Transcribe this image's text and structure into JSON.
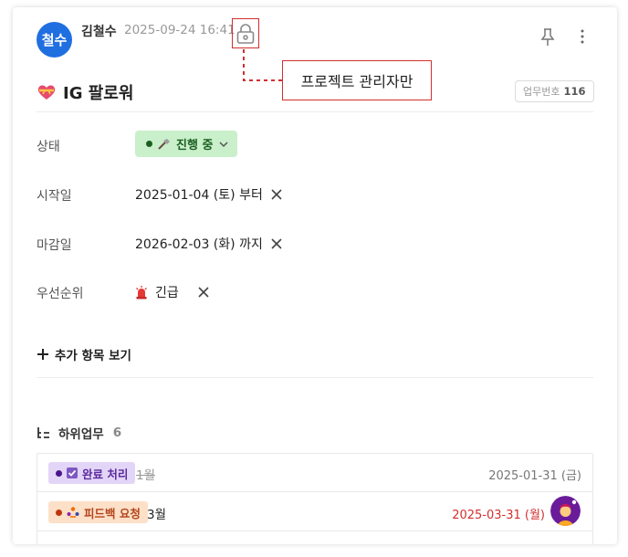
{
  "header": {
    "avatar_text": "철수",
    "author": "김철수",
    "timestamp": "2025-09-24 16:41",
    "lock_callout": "프로젝트 관리자만"
  },
  "task": {
    "title": "IG 팔로워",
    "id_label": "업무번호",
    "id_value": "116"
  },
  "properties": {
    "status": {
      "label": "상태",
      "value": "진행 중",
      "color": "#1b5e20",
      "bg": "#c9efcb"
    },
    "start": {
      "label": "시작일",
      "value": "2025-01-04 (토) 부터"
    },
    "due": {
      "label": "마감일",
      "value": "2026-02-03 (화) 까지"
    },
    "priority": {
      "label": "우선순위",
      "value": "긴급"
    }
  },
  "more_items_label": "추가 항목 보기",
  "subtasks": {
    "title": "하위업무",
    "count": "6",
    "rows": [
      {
        "status": "완료 처리",
        "status_color": "#5b2a9e",
        "status_bg": "#e3d5f7",
        "name": "1월",
        "strikethrough": true,
        "date": "2025-01-31 (금)",
        "date_color": "#777"
      },
      {
        "status": "피드백 요청",
        "status_color": "#b4441c",
        "status_bg": "#fde0c8",
        "name": "3월",
        "strikethrough": false,
        "date": "2025-03-31 (월)",
        "date_color": "#d32f2f"
      }
    ]
  }
}
